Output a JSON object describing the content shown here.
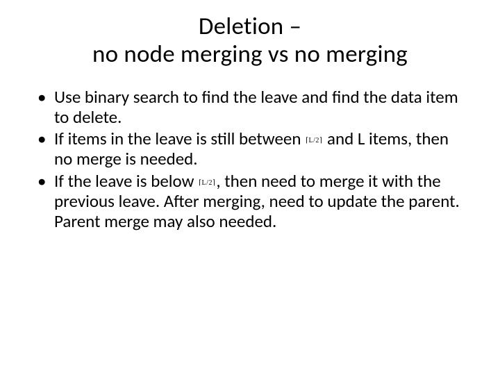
{
  "title_line1": "Deletion –",
  "title_line2": "no node merging  vs no merging",
  "bullets": [
    {
      "before": "Use binary search to find the leave and find the data item to delete.",
      "ceil": "",
      "after": ""
    },
    {
      "before": "If items in the leave is still between ",
      "ceil": "⌈L/2⌉",
      "after": " and L items, then no merge is needed."
    },
    {
      "before": "If the leave is below ",
      "ceil": "⌈L/2⌉",
      "after": ", then need to merge it with the previous leave. After merging, need to update the parent. Parent merge may also needed."
    }
  ]
}
